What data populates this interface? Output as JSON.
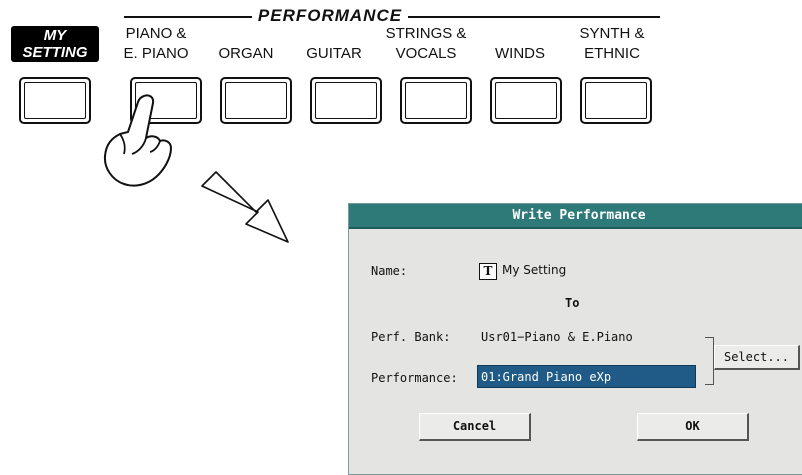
{
  "panel": {
    "section_title": "PERFORMANCE",
    "my_setting": {
      "line1": "MY",
      "line2": "SETTING"
    },
    "categories": [
      {
        "line1": "PIANO &",
        "line2": "E. PIANO"
      },
      {
        "line1": "",
        "line2": "ORGAN"
      },
      {
        "line1": "",
        "line2": "GUITAR"
      },
      {
        "line1": "STRINGS &",
        "line2": "VOCALS"
      },
      {
        "line1": "",
        "line2": "WINDS"
      },
      {
        "line1": "SYNTH &",
        "line2": "ETHNIC"
      }
    ]
  },
  "dialog": {
    "title": "Write Performance",
    "name_label": "Name:",
    "name_icon": "T",
    "name_value": "My Setting",
    "to_label": "To",
    "bank_label": "Perf. Bank:",
    "bank_value": "Usr01−Piano & E.Piano",
    "performance_label": "Performance:",
    "performance_value": "01:Grand Piano eXp",
    "select_button": "Select...",
    "cancel_button": "Cancel",
    "ok_button": "OK"
  },
  "colors": {
    "title_bar": "#2d7a78",
    "selected_field": "#1f5b86",
    "dialog_bg": "#e4e4e2"
  }
}
